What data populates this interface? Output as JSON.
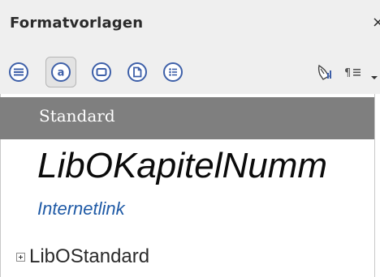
{
  "panel": {
    "title": "Formatvorlagen",
    "close_glyph": "×"
  },
  "toolbar": {
    "buttons": [
      {
        "icon": "paragraph-styles-icon"
      },
      {
        "icon": "character-styles-icon",
        "active": true
      },
      {
        "icon": "frame-styles-icon"
      },
      {
        "icon": "page-styles-icon"
      },
      {
        "icon": "list-styles-icon"
      }
    ],
    "fill_format_icon": "fill-format-mode-icon",
    "new_style_icon": "new-style-from-selection-icon",
    "menu_icon": "chevron-down-icon"
  },
  "styles_list": {
    "selected": "Standard",
    "items": [
      {
        "label": "LibOKapitelNumm"
      },
      {
        "label": "Internetlink"
      },
      {
        "label": "LibOStandard"
      }
    ]
  },
  "colors": {
    "selection_bg": "#7f7f7f",
    "link_color": "#1f5aa6",
    "icon_color": "#3d5fa8"
  }
}
